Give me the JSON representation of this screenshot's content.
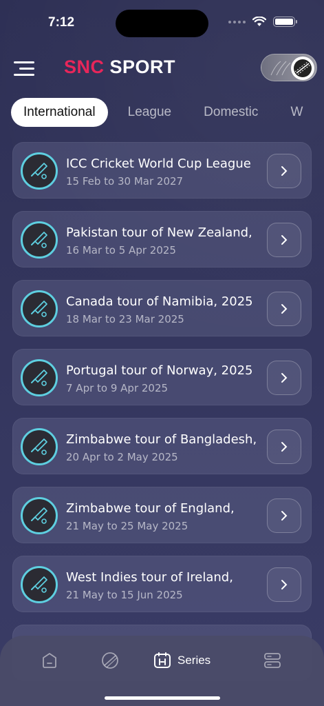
{
  "status_bar": {
    "time": "7:12"
  },
  "header": {
    "logo_part1": "SNC",
    "logo_part2": "SPORT"
  },
  "tabs": [
    {
      "label": "International",
      "active": true
    },
    {
      "label": "League",
      "active": false
    },
    {
      "label": "Domestic",
      "active": false
    },
    {
      "label": "W",
      "active": false
    }
  ],
  "series": [
    {
      "title": "ICC Cricket World Cup League",
      "dates": "15 Feb to 30 Mar 2027"
    },
    {
      "title": "Pakistan tour of New Zealand,",
      "dates": "16 Mar to 5 Apr 2025"
    },
    {
      "title": "Canada tour of Namibia, 2025",
      "dates": "18 Mar to 23 Mar 2025"
    },
    {
      "title": "Portugal tour of Norway, 2025",
      "dates": "7 Apr to 9 Apr 2025"
    },
    {
      "title": "Zimbabwe tour of Bangladesh,",
      "dates": "20 Apr to 2 May 2025"
    },
    {
      "title": "Zimbabwe tour of England,",
      "dates": "21 May to 25 May 2025"
    },
    {
      "title": "West Indies tour of Ireland,",
      "dates": "21 May to 15 Jun 2025"
    }
  ],
  "bottom_nav": {
    "series_label": "Series"
  },
  "colors": {
    "brand_red": "#e8265a",
    "accent_cyan": "#5ecfe0",
    "background": "#2f3156"
  }
}
